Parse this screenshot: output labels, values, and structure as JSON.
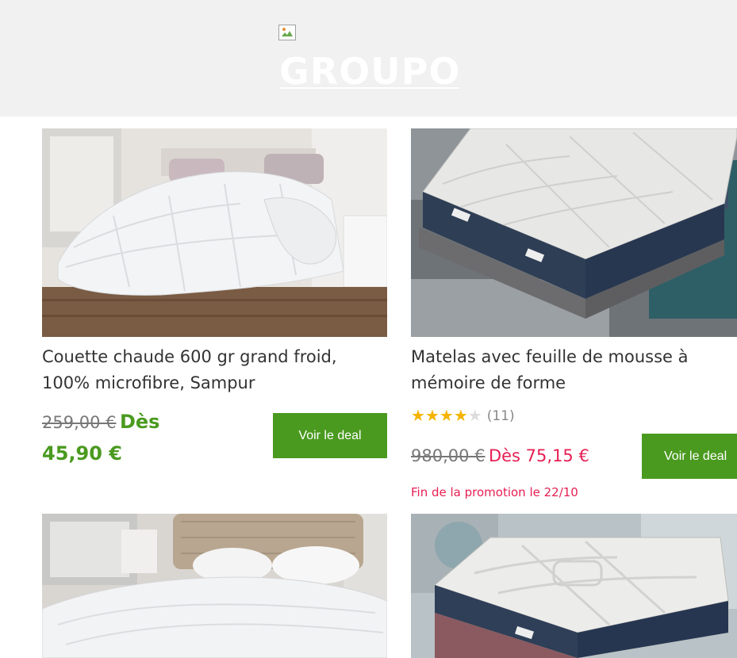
{
  "header": {
    "brand": "GROUPO",
    "logo_icon": "broken-image-icon",
    "background": "#f1f1f1"
  },
  "colors": {
    "accent_green": "#4a9a1f",
    "promo_red": "#e61f52"
  },
  "products": [
    {
      "title": "Couette chaude 600 gr grand froid, 100% microfibre, Sampur",
      "old_price": "259,00 €",
      "new_price": "Dès 45,90 €",
      "button": "Voir le deal"
    },
    {
      "title": "Matelas avec feuille de mousse à mémoire de forme",
      "rating": 4,
      "rating_max": 5,
      "rating_count": "(11)",
      "old_price": "980,00 €",
      "new_price": "Dès 75,15 €",
      "button": "Voir le deal",
      "promo": "Fin de la promotion le 22/10"
    },
    {
      "image": "mattress-topper"
    },
    {
      "image": "mattress"
    }
  ]
}
